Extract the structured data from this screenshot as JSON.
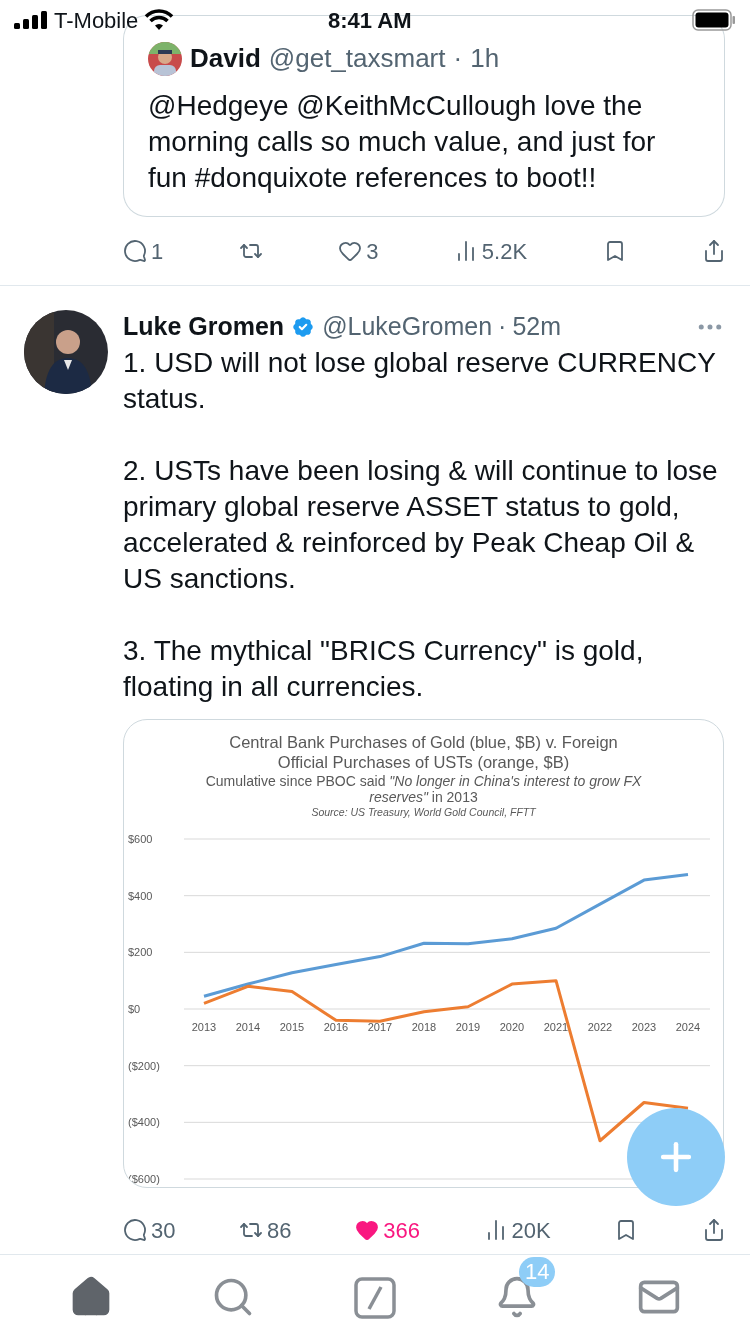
{
  "status_bar": {
    "carrier": "T-Mobile",
    "time": "8:41 AM"
  },
  "quoted_tweet": {
    "name": "David",
    "handle": "@get_taxsmart",
    "dot": "·",
    "time": "1h",
    "text": "@Hedgeye @KeithMcCullough love the morning calls so much value, and just for fun #donquixote references to boot!!"
  },
  "quoted_actions": [
    {
      "kind": "reply",
      "count": "1"
    },
    {
      "kind": "repost"
    },
    {
      "kind": "like",
      "count": "3",
      "liked": false
    },
    {
      "kind": "views",
      "count": "5.2K"
    },
    {
      "kind": "bookmark"
    },
    {
      "kind": "share"
    }
  ],
  "tweet": {
    "name": "Luke Gromen",
    "handle": "@LukeGromen",
    "dot": "·",
    "time": "52m",
    "verified": true,
    "paragraphs": [
      "1. USD will not lose global reserve CURRENCY status.",
      "2. USTs have been losing & will continue to lose primary global reserve ASSET status to gold, accelerated & reinforced by Peak Cheap Oil & US sanctions.",
      "3. The mythical \"BRICS Currency\" is gold, floating in all currencies."
    ],
    "chart_data": {
      "type": "line",
      "title": "Central Bank Purchases of Gold (blue, $B) v. Foreign Official Purchases of USTs (orange, $B)",
      "subtitle": "Cumulative since PBOC said *\"No longer in China's interest to grow FX reserves\"* in 2013",
      "annotations": [
        "Source: US Treasury, World Gold Council, FFTT"
      ],
      "grid": true,
      "categories": [
        "2013",
        "2014",
        "2015",
        "2016",
        "2017",
        "2018",
        "2019",
        "2020",
        "2021",
        "2022",
        "2023",
        "2024"
      ],
      "series": [
        {
          "color": "#5b9bd5",
          "values": [
            45,
            88,
            128,
            157,
            185,
            232,
            230,
            248,
            285,
            370,
            455,
            475
          ]
        },
        {
          "color": "#ed7d31",
          "values": [
            20,
            80,
            62,
            -40,
            -43,
            -10,
            8,
            88,
            100,
            -465,
            -330,
            -350
          ]
        }
      ],
      "ylim": [
        -600,
        600
      ],
      "yticks": [
        {
          "value": 600,
          "label": "$600"
        },
        {
          "value": 400,
          "label": "$400"
        },
        {
          "value": 200,
          "label": "$200"
        },
        {
          "value": 0,
          "label": "$0"
        },
        {
          "value": -200,
          "label": "($200)"
        },
        {
          "value": -400,
          "label": "($400)"
        },
        {
          "value": -600,
          "label": "($600)"
        }
      ]
    }
  },
  "actions": [
    {
      "kind": "reply",
      "count": "30"
    },
    {
      "kind": "repost",
      "count": "86"
    },
    {
      "kind": "like",
      "count": "366",
      "liked": true
    },
    {
      "kind": "views",
      "count": "20K"
    },
    {
      "kind": "bookmark"
    },
    {
      "kind": "share"
    }
  ],
  "tabs": [
    {
      "kind": "home",
      "selected": true
    },
    {
      "kind": "search",
      "selected": false
    },
    {
      "kind": "grok",
      "selected": false
    },
    {
      "kind": "notifications",
      "selected": false,
      "badge": "14"
    },
    {
      "kind": "messages",
      "selected": false
    }
  ]
}
